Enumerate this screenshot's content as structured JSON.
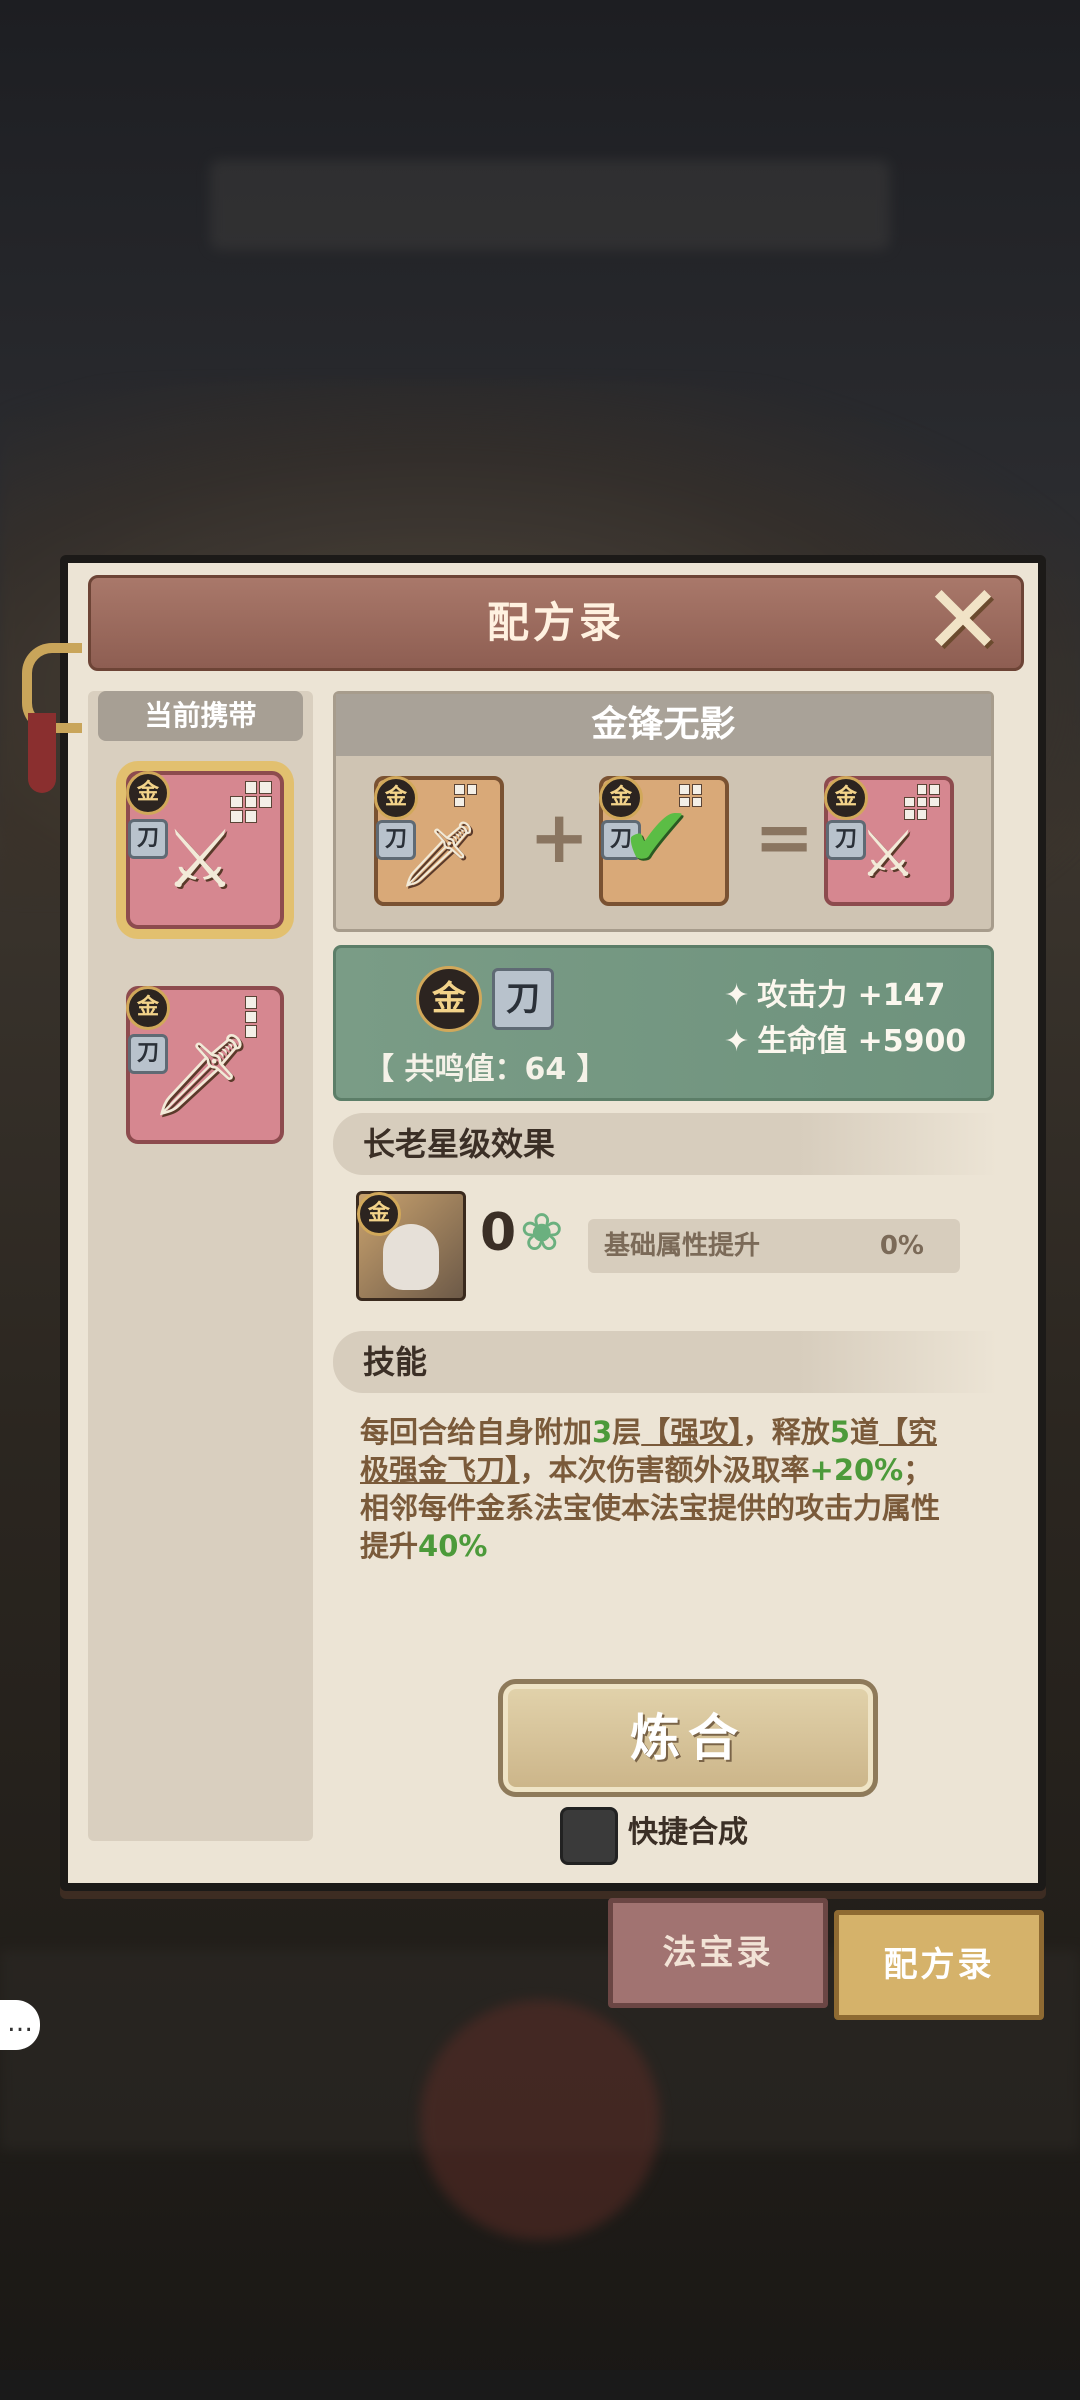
{
  "dialog": {
    "title": "配方录",
    "close_icon": "close-x-icon"
  },
  "left_panel": {
    "label": "当前携带",
    "items": [
      {
        "element": "金",
        "type": "刀",
        "selected": true,
        "art": "crossed-daggers"
      },
      {
        "element": "金",
        "type": "刀",
        "selected": false,
        "art": "golden-blades"
      }
    ]
  },
  "recipe": {
    "name": "金锋无影",
    "inputs": [
      {
        "element": "金",
        "type": "刀",
        "card_color": "#d9a978"
      },
      {
        "element": "金",
        "type": "刀",
        "card_color": "#d9a978",
        "checked": true
      }
    ],
    "output": {
      "element": "金",
      "type": "刀",
      "card_color": "#d68790"
    },
    "plus_symbol": "+",
    "equals_symbol": "="
  },
  "stats": {
    "element": "金",
    "type": "刀",
    "resonance": "【 共鸣值：64 】",
    "attack_label": "攻击力",
    "attack_value": "+147",
    "hp_label": "生命值",
    "hp_value": "+5900"
  },
  "elder": {
    "section_title": "长老星级效果",
    "element": "金",
    "star_count": "0",
    "attr_label": "基础属性提升",
    "attr_value": "0%"
  },
  "skill": {
    "section_title": "技能",
    "p1": "每回合给自身附加",
    "n1": "3",
    "p2": "层",
    "t1": "【强攻】",
    "p3": "，释放",
    "n2": "5",
    "p4": "道",
    "t2": "【究极强金飞刀】",
    "p5": "，本次伤害额外汲取率",
    "n3": "+20%",
    "p6": "；",
    "p7": "相邻每件金系法宝使本法宝提供的攻击力属性提升",
    "n4": "40%"
  },
  "actions": {
    "refine_label": "炼合",
    "quick_synth_label": "快捷合成",
    "quick_synth_checked": false
  },
  "tabs": [
    {
      "label": "法宝录",
      "active": false
    },
    {
      "label": "配方录",
      "active": true
    }
  ],
  "colors": {
    "accent_gold": "#d5b26a",
    "stat_green": "#4c9a3a",
    "panel_green": "#7a9c86",
    "header_brown": "#a9786a"
  }
}
